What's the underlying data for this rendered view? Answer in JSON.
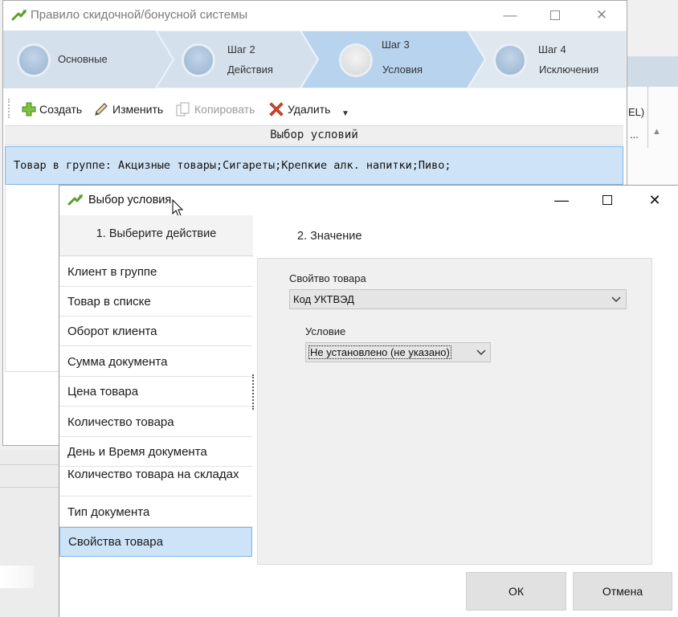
{
  "main_window": {
    "title": "Правило скидочной/бонусной системы",
    "steps": [
      {
        "line1": "Основные",
        "line2": ""
      },
      {
        "line1": "Шаг 2",
        "line2": "Действия"
      },
      {
        "line1": "Шаг 3",
        "line2": "Условия"
      },
      {
        "line1": "Шаг 4",
        "line2": "Исключения"
      }
    ],
    "toolbar": {
      "create": "Создать",
      "edit": "Изменить",
      "copy": "Копировать",
      "delete": "Удалить"
    },
    "grid_header": "Выбор условий",
    "grid_row": "Товар в группе: Акцизные товары;Сигареты;Крепкие алк. напитки;Пиво;"
  },
  "background": {
    "right_text": "EL)",
    "right_ellipsis": "..."
  },
  "dialog": {
    "title": "Выбор условия",
    "left_header": "1. Выберите  действие",
    "right_header": "2. Значение",
    "actions": [
      "Клиент в группе",
      "Товар в списке",
      "Оборот клиента",
      "Сумма документа",
      "Цена товара",
      "Количество товара",
      "День и Время документа",
      "Количество товара на складах",
      "Тип документа",
      "Свойства товара"
    ],
    "selected_action": "Свойства товара",
    "property_label": "Свойтво товара",
    "property_value": "Код УКТВЭД",
    "condition_label": "Условие",
    "condition_value": "Не установлено (не указано)",
    "ok": "ОК",
    "cancel": "Отмена"
  },
  "colors": {
    "selection": "#cde4f8",
    "selection_border": "#7fb4e4",
    "steps_bg": "#dfe7ef",
    "delete_icon": "#d9452b",
    "create_icon": "#7cc242"
  },
  "icons": [
    "app-arrow-icon",
    "plus-icon",
    "pencil-icon",
    "copy-icon",
    "delete-x-icon",
    "chevron-down-icon",
    "minimize-icon",
    "maximize-icon",
    "close-icon",
    "mouse-cursor-icon"
  ]
}
